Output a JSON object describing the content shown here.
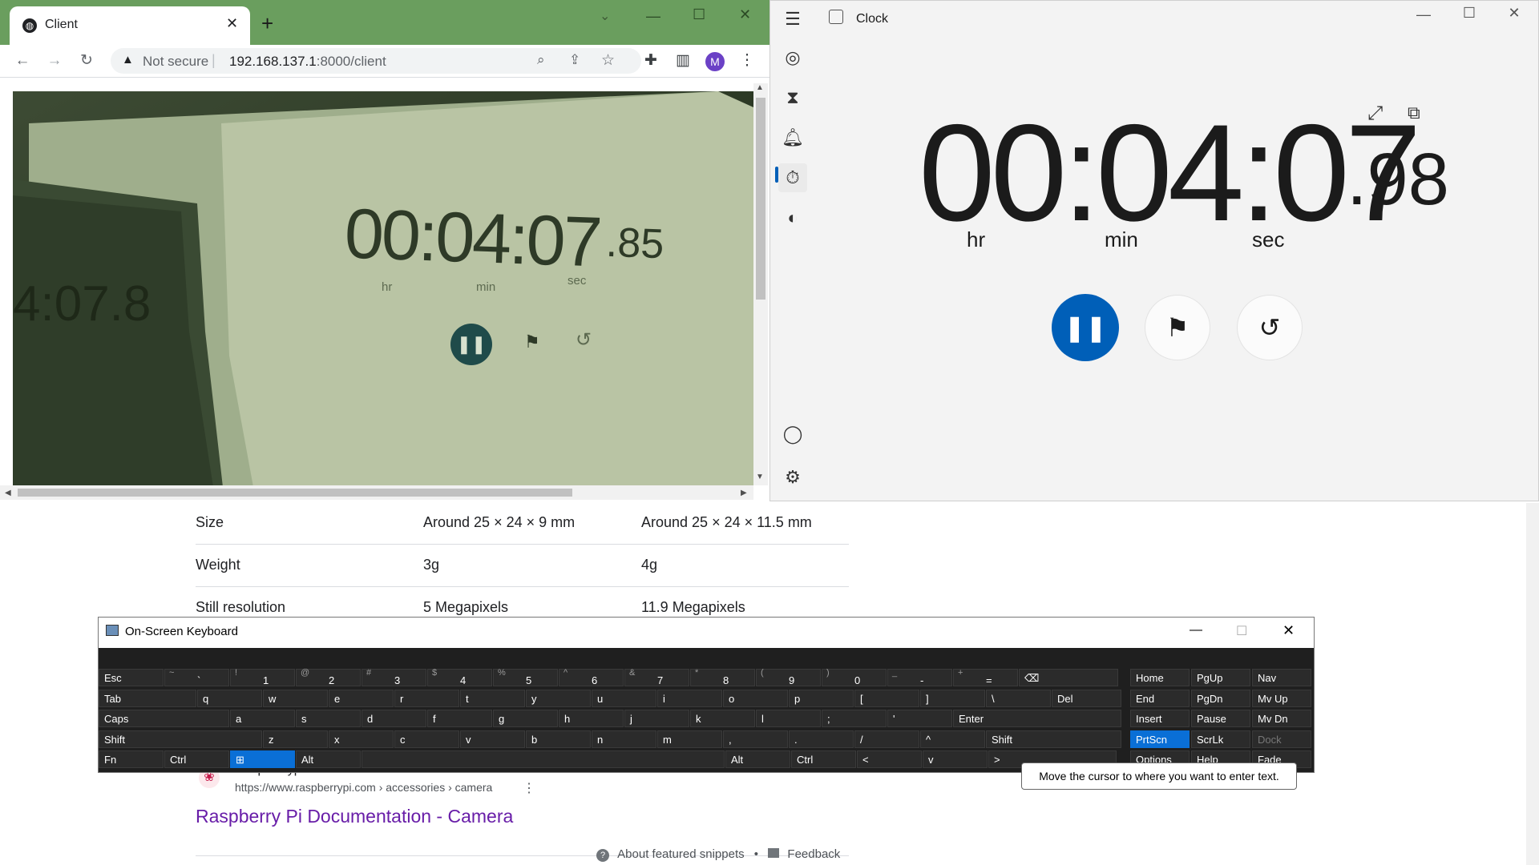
{
  "background_page": {
    "spec_rows": [
      {
        "label": "Size",
        "v2": "Around 25 × 24 × 9 mm",
        "v3": "Around 25 × 24 × 11.5 mm"
      },
      {
        "label": "Weight",
        "v2": "3g",
        "v3": "4g"
      },
      {
        "label": "Still resolution",
        "v2": "5 Megapixels",
        "v3": "11.9 Megapixels"
      }
    ],
    "result_site": "Raspberrypi.com",
    "result_url": "https://www.raspberrypi.com › accessories › camera",
    "result_title": "Raspberry Pi Documentation - Camera",
    "about_snippets": "About featured snippets",
    "separator": "•",
    "feedback": "Feedback"
  },
  "browser": {
    "tab_title": "Client",
    "security_label": "Not secure",
    "url_host": "192.168.137.1",
    "url_path": ":8000/client",
    "profile_initial": "M",
    "camera_feed": {
      "time": "00:04:07",
      "fraction": ".85",
      "units": [
        "hr",
        "min",
        "sec"
      ],
      "left_time": "4:07.8"
    }
  },
  "clock": {
    "title": "Clock",
    "hours": "00",
    "minutes": "04",
    "seconds": "07",
    "fraction": ".98",
    "unit_hr": "hr",
    "unit_min": "min",
    "unit_sec": "sec",
    "accent_color": "#005fb8"
  },
  "osk": {
    "title": "On-Screen Keyboard",
    "tooltip": "Move the cursor to where you want to enter text.",
    "row1": [
      {
        "m": "Esc",
        "s": ""
      },
      {
        "m": "`",
        "s": "~"
      },
      {
        "m": "1",
        "s": "!"
      },
      {
        "m": "2",
        "s": "@"
      },
      {
        "m": "3",
        "s": "#"
      },
      {
        "m": "4",
        "s": "$"
      },
      {
        "m": "5",
        "s": "%"
      },
      {
        "m": "6",
        "s": "^"
      },
      {
        "m": "7",
        "s": "&"
      },
      {
        "m": "8",
        "s": "*"
      },
      {
        "m": "9",
        "s": "("
      },
      {
        "m": "0",
        "s": ")"
      },
      {
        "m": "-",
        "s": "_"
      },
      {
        "m": "=",
        "s": "+"
      },
      {
        "m": "⌫",
        "s": ""
      }
    ],
    "row2": [
      "Tab",
      "q",
      "w",
      "e",
      "r",
      "t",
      "y",
      "u",
      "i",
      "o",
      "p",
      "[",
      "]",
      "\\",
      "Del"
    ],
    "row3": [
      "Caps",
      "a",
      "s",
      "d",
      "f",
      "g",
      "h",
      "j",
      "k",
      "l",
      ";",
      "'",
      "Enter"
    ],
    "row4": [
      "Shift",
      "z",
      "x",
      "c",
      "v",
      "b",
      "n",
      "m",
      ",",
      ".",
      "/",
      "^",
      "Shift"
    ],
    "row5": [
      "Fn",
      "Ctrl",
      "⊞",
      "Alt",
      "",
      "Alt",
      "Ctrl",
      "<",
      "v",
      ">"
    ],
    "nav_keys": [
      [
        "Home",
        "PgUp",
        "Nav"
      ],
      [
        "End",
        "PgDn",
        "Mv Up"
      ],
      [
        "Insert",
        "Pause",
        "Mv Dn"
      ],
      [
        "PrtScn",
        "ScrLk",
        "Dock"
      ],
      [
        "Options",
        "Help",
        "Fade"
      ]
    ]
  }
}
